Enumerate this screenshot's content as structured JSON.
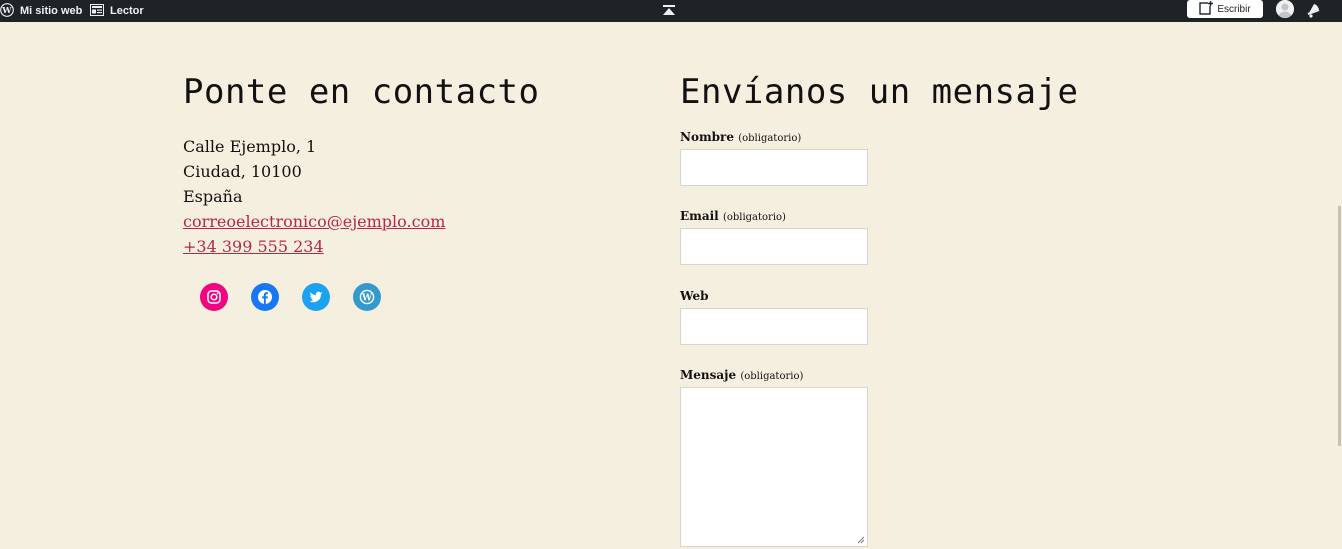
{
  "adminbar": {
    "site_label": "Mi sitio web",
    "reader_label": "Lector",
    "write_label": "Escribir"
  },
  "contact": {
    "heading": "Ponte en contacto",
    "street": "Calle Ejemplo, 1",
    "city": "Ciudad, 10100",
    "country": "España",
    "email": "correoelectronico@ejemplo.com",
    "phone": "+34 399 555 234",
    "socials": [
      {
        "name": "instagram",
        "color": "#f0047f"
      },
      {
        "name": "facebook",
        "color": "#1877f2"
      },
      {
        "name": "twitter",
        "color": "#1da1f2"
      },
      {
        "name": "wordpress",
        "color": "#3499cd"
      }
    ]
  },
  "form": {
    "heading": "Envíanos un mensaje",
    "name_label": "Nombre",
    "email_label": "Email",
    "web_label": "Web",
    "message_label": "Mensaje",
    "required_note": "(obligatorio)"
  }
}
